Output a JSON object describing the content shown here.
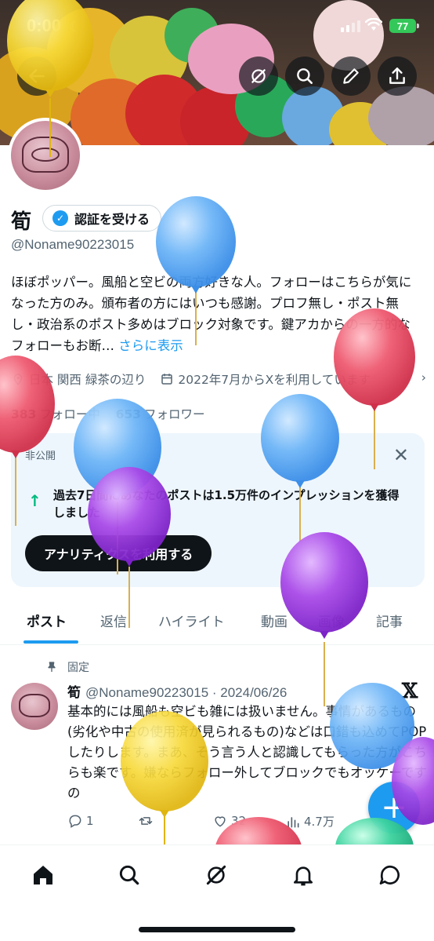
{
  "status_bar": {
    "time": "0:00",
    "battery": "77"
  },
  "profile": {
    "name": "筍",
    "verify_label": "認証を受ける",
    "handle": "@Noname90223015",
    "bio": "ほぼポッパー。風船と空ビの両方好きな人。フォローはこちらが気になった方のみ。頒布者の方にはいつも感謝。プロフ無し・ポスト無し・政治系のポスト多めはブロック対象です。鍵アカからの一方的なフォローもお断…",
    "bio_more": "さらに表示",
    "location": "日本 関西 緑茶の辺り",
    "joined": "2022年7月からXを利用しています",
    "following_count": "383",
    "following_label": "フォロー中",
    "followers_count": "653",
    "followers_label": "フォロワー"
  },
  "analytics_card": {
    "tag": "非公開",
    "text": "過去7日間にあなたのポストは1.5万件のインプレッションを獲得しました",
    "button_label": "アナリティクスを利用する"
  },
  "tabs": [
    "ポスト",
    "返信",
    "ハイライト",
    "動画",
    "画像",
    "記事"
  ],
  "post": {
    "pinned_label": "固定",
    "author": "筍",
    "handle_date": "@Noname90223015 · 2024/06/26",
    "text": "基本的には風船も空ビも雑には扱いません。事情があるもの(劣化や中古の使用済が見られるもの)などは口錯も込めてPOPしたりします。まあ、そう言う人と認識してもらった方がこちらも楽です。嫌ならフォロー外してブロックでもオッケーですの",
    "replies": "1",
    "likes": "32",
    "views": "4.7万"
  },
  "icons": {
    "back": "back-arrow-icon",
    "grok": "grok-icon",
    "search": "search-icon",
    "edit": "edit-pencil-icon",
    "share": "share-icon"
  },
  "colors": {
    "accent": "#1d9bf0",
    "positive": "#00ba7c",
    "text": "#0f1419",
    "muted": "#536471"
  }
}
